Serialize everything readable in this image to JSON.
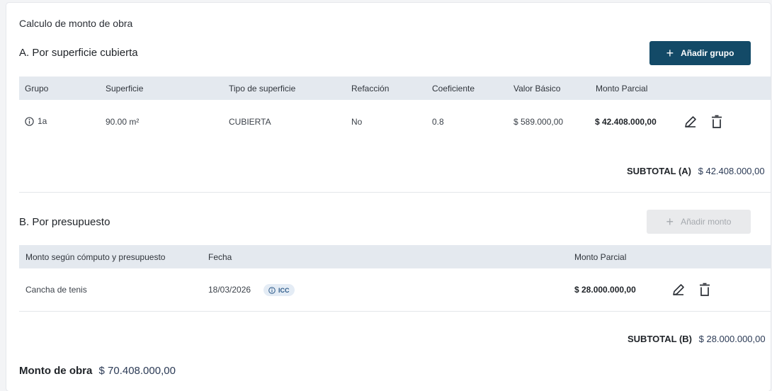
{
  "card": {
    "title": "Calculo de monto de obra"
  },
  "section_a": {
    "title": "A. Por superficie cubierta",
    "add_button": "Añadir grupo",
    "headers": [
      "Grupo",
      "Superficie",
      "Tipo de superficie",
      "Refacción",
      "Coeficiente",
      "Valor Básico",
      "Monto Parcial"
    ],
    "rows": [
      {
        "grupo": "1a",
        "superficie": "90.00 m²",
        "tipo": "CUBIERTA",
        "refaccion": "No",
        "coeficiente": "0.8",
        "valor_basico": "$ 589.000,00",
        "monto_parcial": "$ 42.408.000,00"
      }
    ],
    "subtotal_label": "SUBTOTAL (A)",
    "subtotal_value": "$ 42.408.000,00"
  },
  "section_b": {
    "title": "B. Por presupuesto",
    "add_button": "Añadir monto",
    "headers": [
      "Monto según cómputo y presupuesto",
      "Fecha",
      "Monto Parcial"
    ],
    "rows": [
      {
        "descripcion": "Cancha de tenis",
        "fecha": "18/03/2026",
        "badge": "ICC",
        "monto_parcial": "$ 28.000.000,00"
      }
    ],
    "subtotal_label": "SUBTOTAL (B)",
    "subtotal_value": "$ 28.000.000,00"
  },
  "total": {
    "label": "Monto de obra",
    "value": "$ 70.408.000,00"
  },
  "icons": {
    "info": "info-icon",
    "edit": "pencil-icon",
    "delete": "trash-icon",
    "add": "plus-icon"
  },
  "colors": {
    "primary": "#134a67",
    "header_bg": "#e4e9ef",
    "disabled_bg": "#e9eaec",
    "badge_bg": "#e4ecf5"
  }
}
